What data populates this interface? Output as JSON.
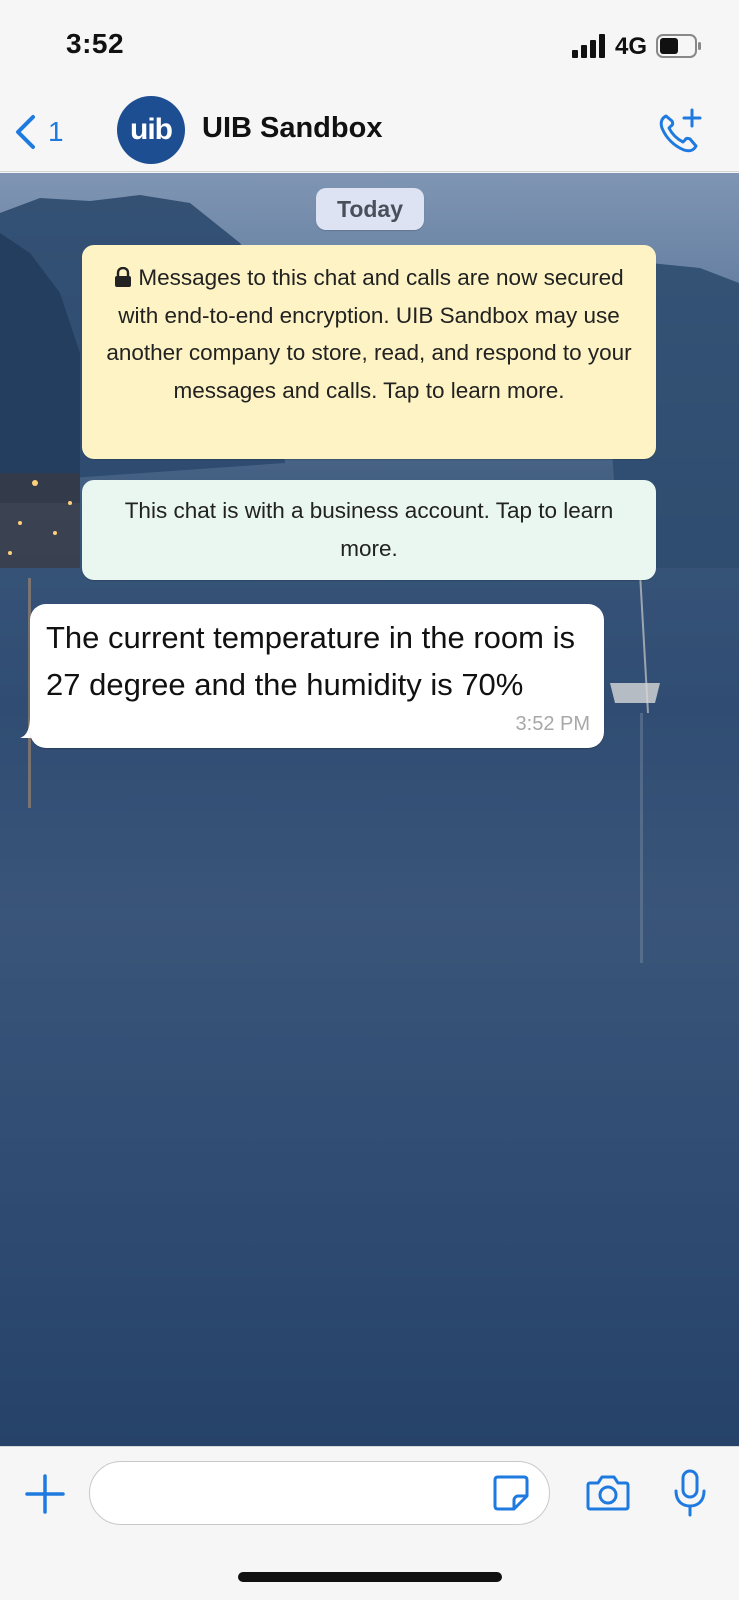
{
  "status_bar": {
    "time": "3:52",
    "network": "4G"
  },
  "header": {
    "back_count": "1",
    "avatar_text": "uib",
    "title": "UIB Sandbox"
  },
  "chat": {
    "date_label": "Today",
    "encryption_notice": "Messages to this chat and calls are now secured with end-to-end encryption. UIB Sandbox may use another company to store, read, and respond to your messages and calls. Tap to learn more.",
    "business_notice": "This chat is with a business account. Tap to learn more.",
    "messages": [
      {
        "text": "The current temperature in the room is 27 degree and the humidity is 70%",
        "time": "3:52 PM",
        "direction": "incoming"
      }
    ]
  },
  "input_bar": {
    "placeholder": ""
  },
  "colors": {
    "accent": "#1f7ae0",
    "encryption_bg": "#fdf3c4",
    "business_bg": "#eaf7f1",
    "date_pill_bg": "#dde3f2"
  },
  "icons": [
    "back-chevron-icon",
    "call-add-icon",
    "lock-icon",
    "plus-icon",
    "sticker-icon",
    "camera-icon",
    "microphone-icon"
  ]
}
